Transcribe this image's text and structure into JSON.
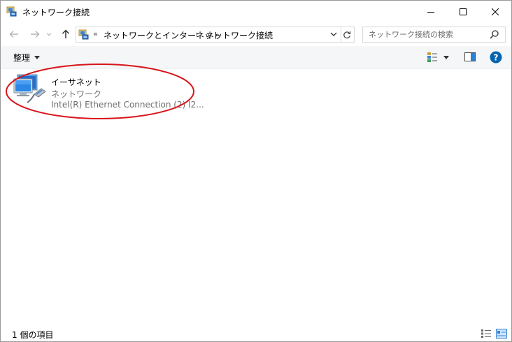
{
  "window": {
    "title": "ネットワーク接続",
    "controls": {
      "minimize": "minimize-icon",
      "maximize": "maximize-icon",
      "close": "close-icon"
    }
  },
  "navigation": {
    "back_icon": "arrow-left-icon",
    "forward_icon": "arrow-right-icon",
    "recent_icon": "chevron-down-icon",
    "up_icon": "arrow-up-icon"
  },
  "address": {
    "overflow": "«",
    "breadcrumbs": [
      "ネットワークとインターネット",
      "ネットワーク接続"
    ],
    "separator": "›",
    "refresh_icon": "refresh-icon"
  },
  "search": {
    "placeholder": "ネットワーク接続の検索",
    "value": ""
  },
  "toolbar": {
    "organize_label": "整理",
    "view_icon": "change-view-icon",
    "preview_pane_icon": "preview-pane-icon",
    "help_icon": "help-icon"
  },
  "connections": [
    {
      "name": "イーサネット",
      "status": "ネットワーク",
      "device": "Intel(R) Ethernet Connection (2) I2...",
      "icon": "ethernet-adapter-icon"
    }
  ],
  "statusbar": {
    "item_count": "1 個の項目",
    "details_view_icon": "details-view-icon",
    "tiles_view_icon": "tiles-view-icon"
  },
  "colors": {
    "accent": "#0063b1",
    "highlight_ellipse": "#d8141b",
    "toolbar_bg": "#f5f6f7",
    "secondary_text": "#6d6d6d"
  }
}
